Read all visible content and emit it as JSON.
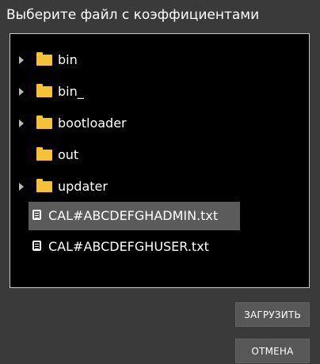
{
  "dialog": {
    "title": "Выберите файл с коэффициентами"
  },
  "tree": {
    "folders": [
      {
        "label": "bin",
        "expandable": true,
        "icon": "folder-icon"
      },
      {
        "label": "bin_",
        "expandable": true,
        "icon": "folder-icon"
      },
      {
        "label": "bootloader",
        "expandable": true,
        "icon": "folder-icon"
      },
      {
        "label": "out",
        "expandable": false,
        "icon": "folder-icon"
      },
      {
        "label": "updater",
        "expandable": true,
        "icon": "folder-icon"
      }
    ],
    "files": [
      {
        "label": "CAL#ABCDEFGHADMIN.txt",
        "selected": true,
        "icon": "text-file-icon"
      },
      {
        "label": "CAL#ABCDEFGHUSER.txt",
        "selected": false,
        "icon": "text-file-icon"
      }
    ]
  },
  "buttons": {
    "load_label": "ЗАГРУЗИТЬ",
    "cancel_label": "ОТМЕНА"
  },
  "colors": {
    "background": "#3a3a3a",
    "panel": "#000000",
    "folder": "#f3c236",
    "selection": "#5b5b5b",
    "button": "#575757"
  }
}
